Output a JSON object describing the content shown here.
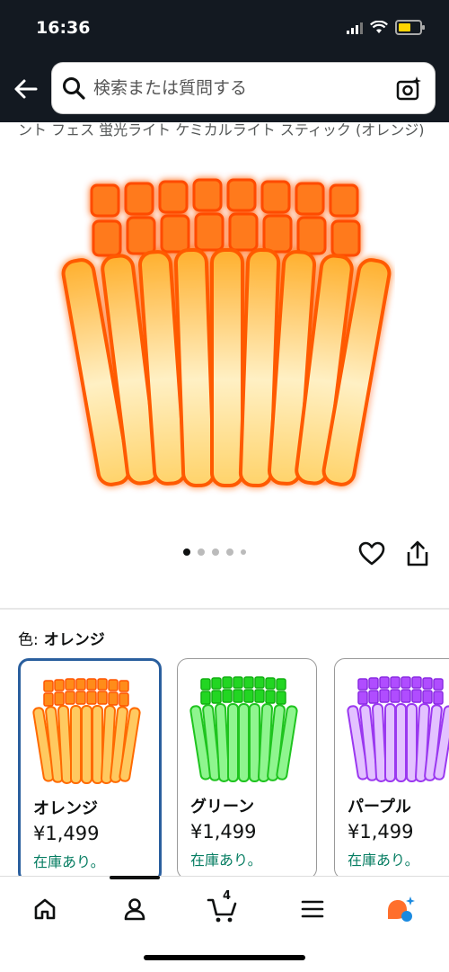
{
  "status": {
    "time": "16:36"
  },
  "search": {
    "placeholder": "検索または質問する"
  },
  "product": {
    "title_snippet": "ント フェス 蛍光ライト ケミカルライト スティック (オレンジ)",
    "image_count": 5,
    "active_image_index": 0
  },
  "variation": {
    "label": "色:",
    "selected": "オレンジ",
    "options": [
      {
        "name": "オレンジ",
        "price": "¥1,499",
        "stock": "在庫あり。",
        "color": "#ff8c1a"
      },
      {
        "name": "グリーン",
        "price": "¥1,499",
        "stock": "在庫あり。",
        "color": "#2ee32e"
      },
      {
        "name": "パープル",
        "price": "¥1,499",
        "stock": "在庫あり。",
        "color": "#b14bff"
      }
    ]
  },
  "nav": {
    "items": [
      "home-icon",
      "account-icon",
      "cart-icon",
      "menu-icon",
      "rufus-icon"
    ],
    "cart_count": "4"
  },
  "colors": {
    "header_bg": "#131921",
    "stock_green": "#067d62",
    "selected_border": "#2a5f9e"
  }
}
